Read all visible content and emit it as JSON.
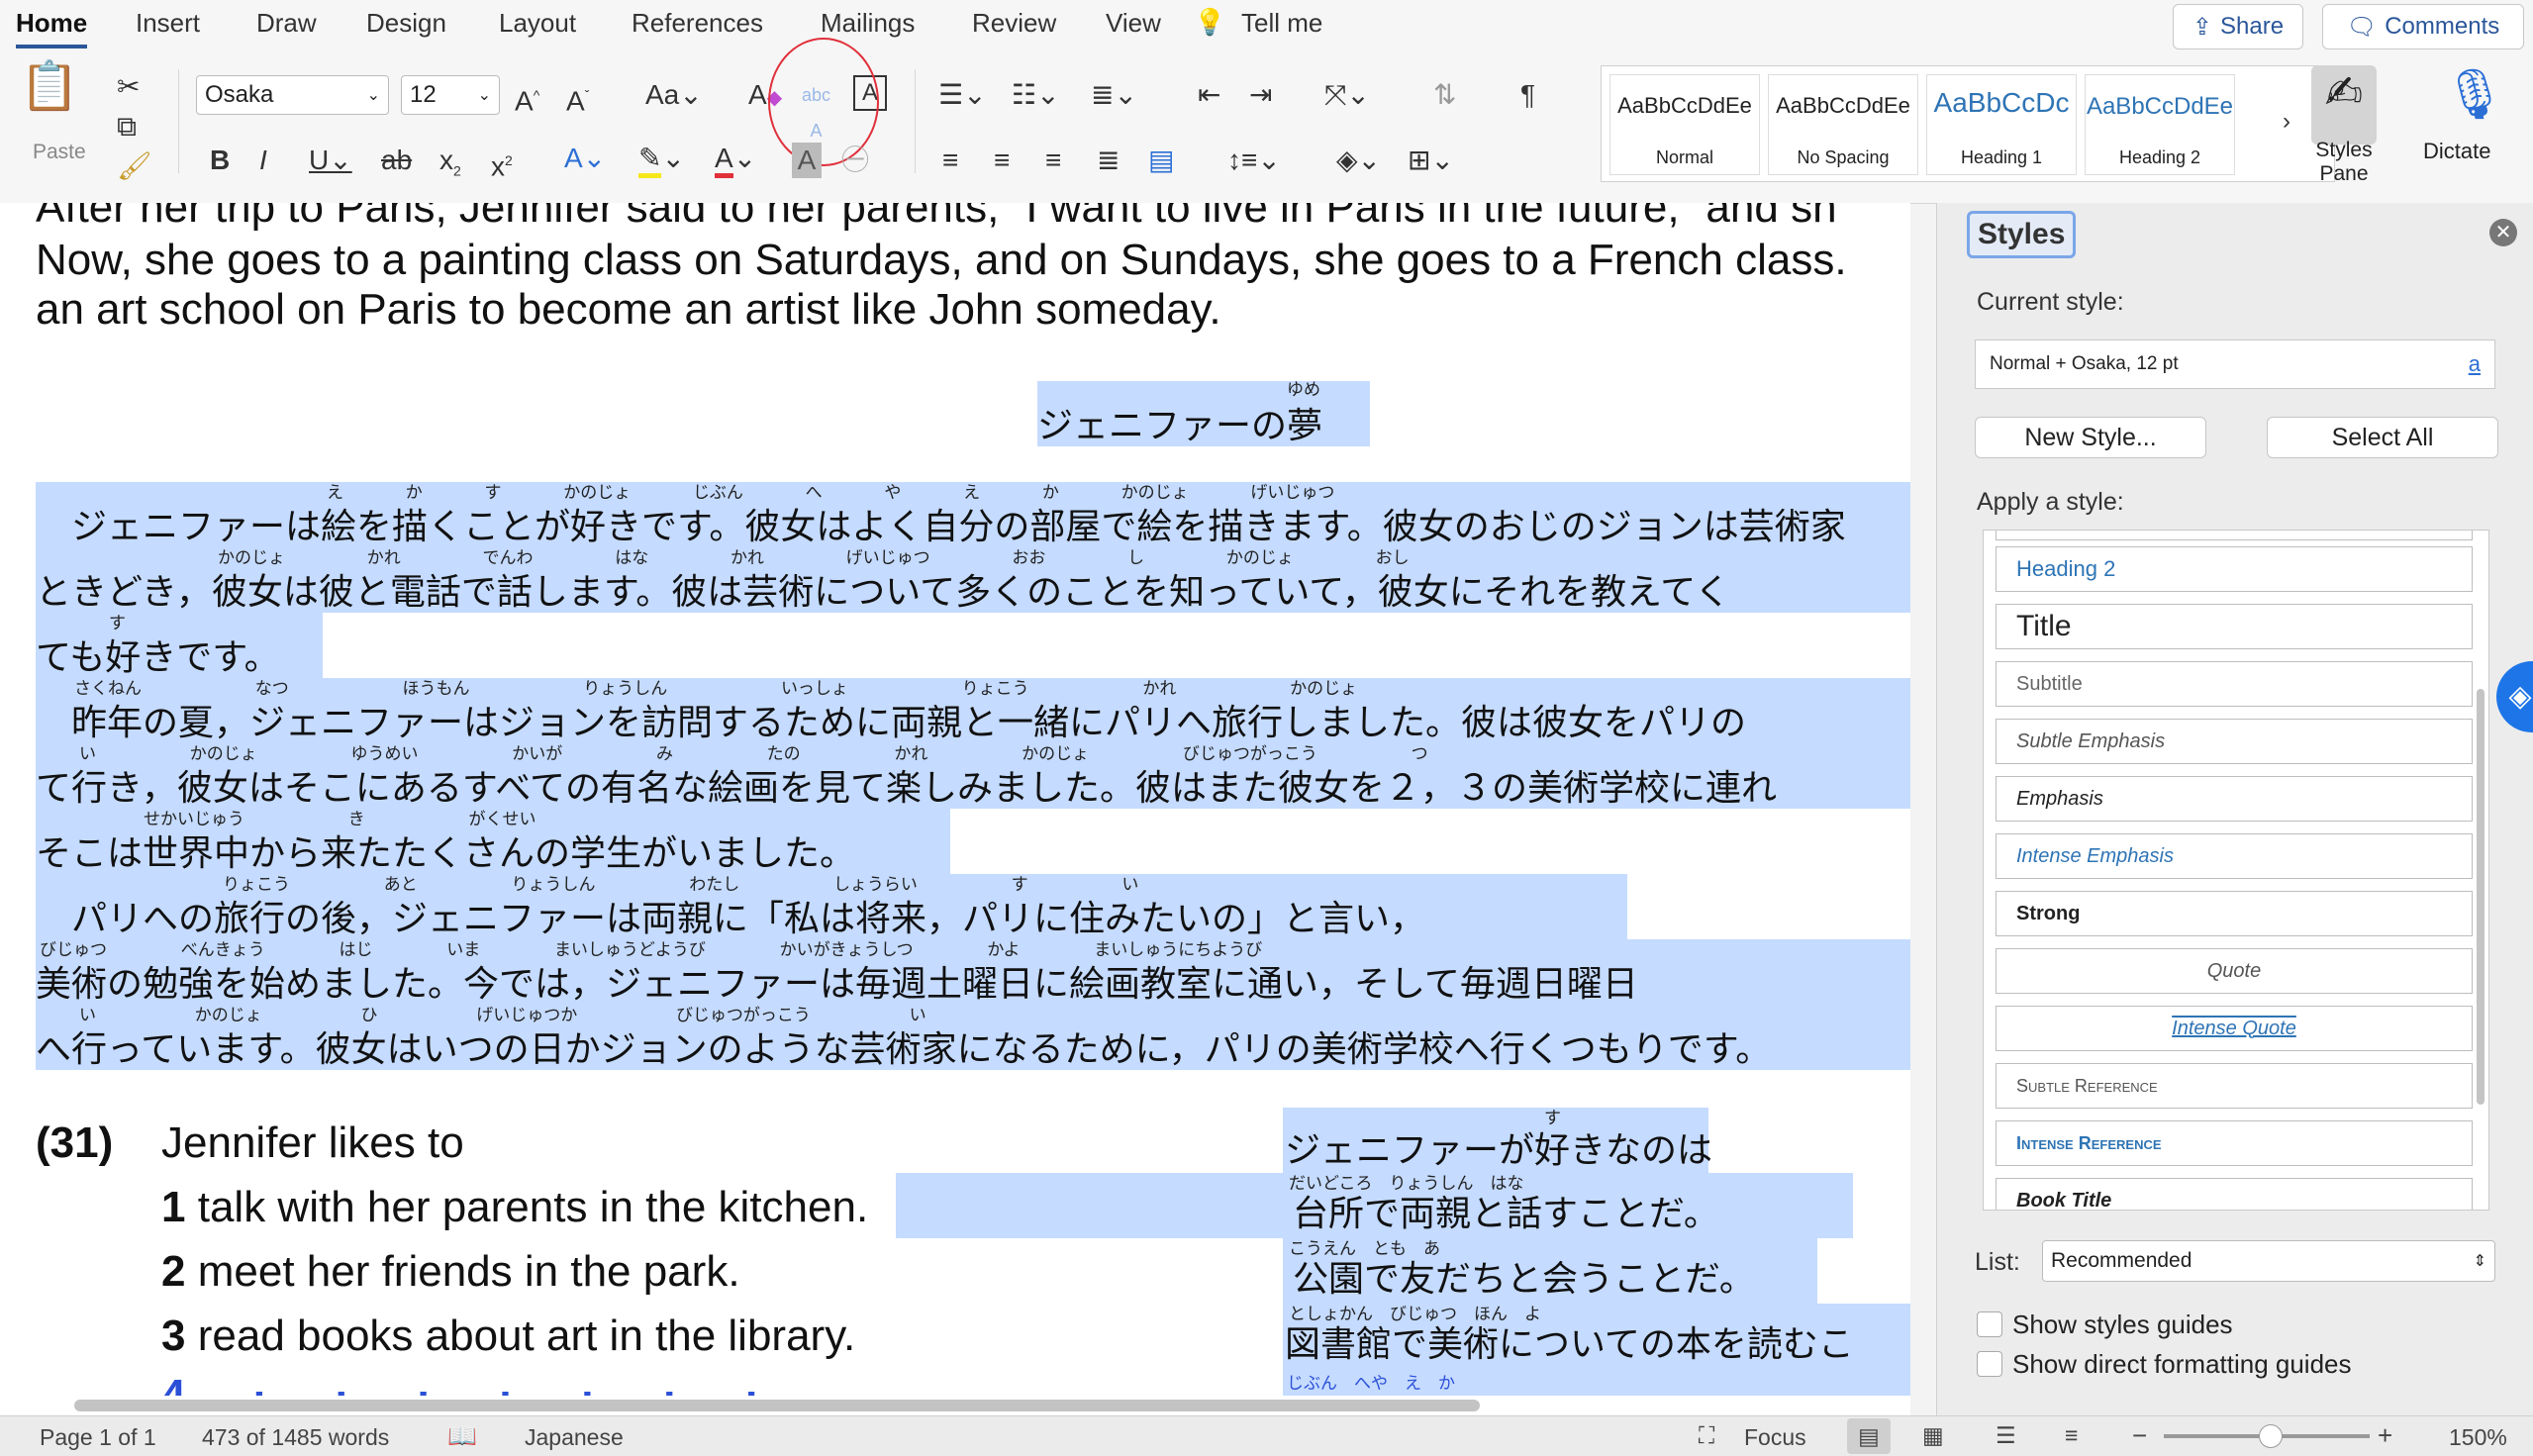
{
  "ribbon": {
    "tabs": [
      "Home",
      "Insert",
      "Draw",
      "Design",
      "Layout",
      "References",
      "Mailings",
      "Review",
      "View",
      "Tell me"
    ],
    "share_label": "Share",
    "comments_label": "Comments",
    "paste_label": "Paste",
    "font_name": "Osaka",
    "font_size": "12",
    "styles": [
      {
        "preview": "AaBbCcDdEe",
        "name": "Normal"
      },
      {
        "preview": "AaBbCcDdEe",
        "name": "No Spacing"
      },
      {
        "preview": "AaBbCcDc",
        "name": "Heading 1"
      },
      {
        "preview": "AaBbCcDdEe",
        "name": "Heading 2"
      }
    ],
    "styles_pane_label": "Styles Pane",
    "dictate_label": "Dictate"
  },
  "document": {
    "en_lines": [
      "After her trip to Paris, Jennifer said to her parents, “I want to live in Paris in the future,” and sh",
      "Now, she goes to a painting class on Saturdays, and on Sundays, she goes to a French class.",
      "an art school on Paris to become an artist like John someday."
    ],
    "jp_title": "ジェニファーの夢",
    "jp_title_furi": "ゆめ",
    "jp_lines": [
      "　ジェニファーは絵を描くことが好きです。彼女はよく自分の部屋で絵を描きます。彼女のおじのジョンは芸術家",
      "ときどき，彼女は彼と電話で話します。彼は芸術について多くのことを知っていて，彼女にそれを教えてく",
      "ても好きです。",
      "　昨年の夏，ジェニファーはジョンを訪問するために両親と一緒にパリへ旅行しました。彼は彼女をパリの",
      "て行き，彼女はそこにあるすべての有名な絵画を見て楽しみました。彼はまた彼女を２，３の美術学校に連れ",
      "そこは世界中から来たたくさんの学生がいました。",
      "　パリへの旅行の後，ジェニファーは両親に「私は将来，パリに住みたいの」と言い，",
      "美術の勉強を始めました。今では，ジェニファーは毎週土曜日に絵画教室に通い，そして毎週日曜日",
      "へ行っています。彼女はいつの日かジョンのような芸術家になるために，パリの美術学校へ行くつもりです。"
    ],
    "jp_furigana": [
      [
        "え",
        "か",
        "す",
        "かのじょ",
        "じぶん",
        "へ や",
        "え",
        "か",
        "かのじょ",
        "げいじゅつ"
      ],
      [
        "かのじょ",
        "かれ",
        "でんわ",
        "はな",
        "かれ",
        "げいじゅつ",
        "おお",
        "し",
        "かのじょ",
        "おし"
      ],
      [
        "す"
      ],
      [
        "さくねん",
        "なつ",
        "ほうもん",
        "りょうしん",
        "いっしょ",
        "りょこう",
        "かれ",
        "かのじょ"
      ],
      [
        "い",
        "かのじょ",
        "ゆうめい",
        "かいが",
        "み",
        "たの",
        "かれ",
        "かのじょ",
        "びじゅつがっこう",
        "つ"
      ],
      [
        "せかいじゅう",
        "き",
        "がくせい"
      ],
      [
        "りょこう",
        "あと",
        "りょうしん",
        "わたし",
        "しょうらい",
        "す",
        "い"
      ],
      [
        "びじゅつ",
        "べんきょう",
        "はじ",
        "いま",
        "まいしゅうどようび",
        "かいがきょうしつ",
        "かよ",
        "まいしゅうにちようび"
      ],
      [
        "い",
        "かのじょ",
        "ひ",
        "げいじゅつか",
        "びじゅつがっこう",
        "い"
      ]
    ],
    "question_number": "(31)",
    "question_text": "Jennifer likes to",
    "options": [
      {
        "num": "1",
        "text": "talk with her parents in the kitchen."
      },
      {
        "num": "2",
        "text": "meet her friends in the park."
      },
      {
        "num": "3",
        "text": "read books about art in the library."
      }
    ],
    "jp_answers": [
      {
        "text": "ジェニファーが好きなのは",
        "furi": "す"
      },
      {
        "text": "台所で両親と話すことだ。",
        "furi": "だいどころ　りょうしん　はな"
      },
      {
        "text": "公園で友だちと会うことだ。",
        "furi": "こうえん　とも　あ"
      },
      {
        "text": "図書館で美術についての本を読むこ",
        "furi": "としょかん　びじゅつ　ほん　よ"
      }
    ],
    "partial_line_furi": "じぶん　へや　え　か"
  },
  "styles_pane": {
    "title": "Styles",
    "current_style_label": "Current style:",
    "current_style_value": "Normal + Osaka, 12 pt",
    "new_style_label": "New Style...",
    "select_all_label": "Select All",
    "apply_label": "Apply a style:",
    "style_items": [
      "Heading 2",
      "Title",
      "Subtitle",
      "Subtle Emphasis",
      "Emphasis",
      "Intense Emphasis",
      "Strong",
      "Quote",
      "Intense Quote",
      "Subtle Reference",
      "Intense Reference",
      "Book Title"
    ],
    "list_label": "List:",
    "list_value": "Recommended",
    "show_guides_label": "Show styles guides",
    "show_direct_label": "Show direct formatting guides"
  },
  "status": {
    "page": "Page 1 of 1",
    "words": "473 of 1485 words",
    "language": "Japanese",
    "focus_label": "Focus",
    "zoom": "150%"
  },
  "colors": {
    "accent": "#2b579a",
    "highlight": "#c5dbff",
    "annotation_circle": "#e0303a"
  }
}
